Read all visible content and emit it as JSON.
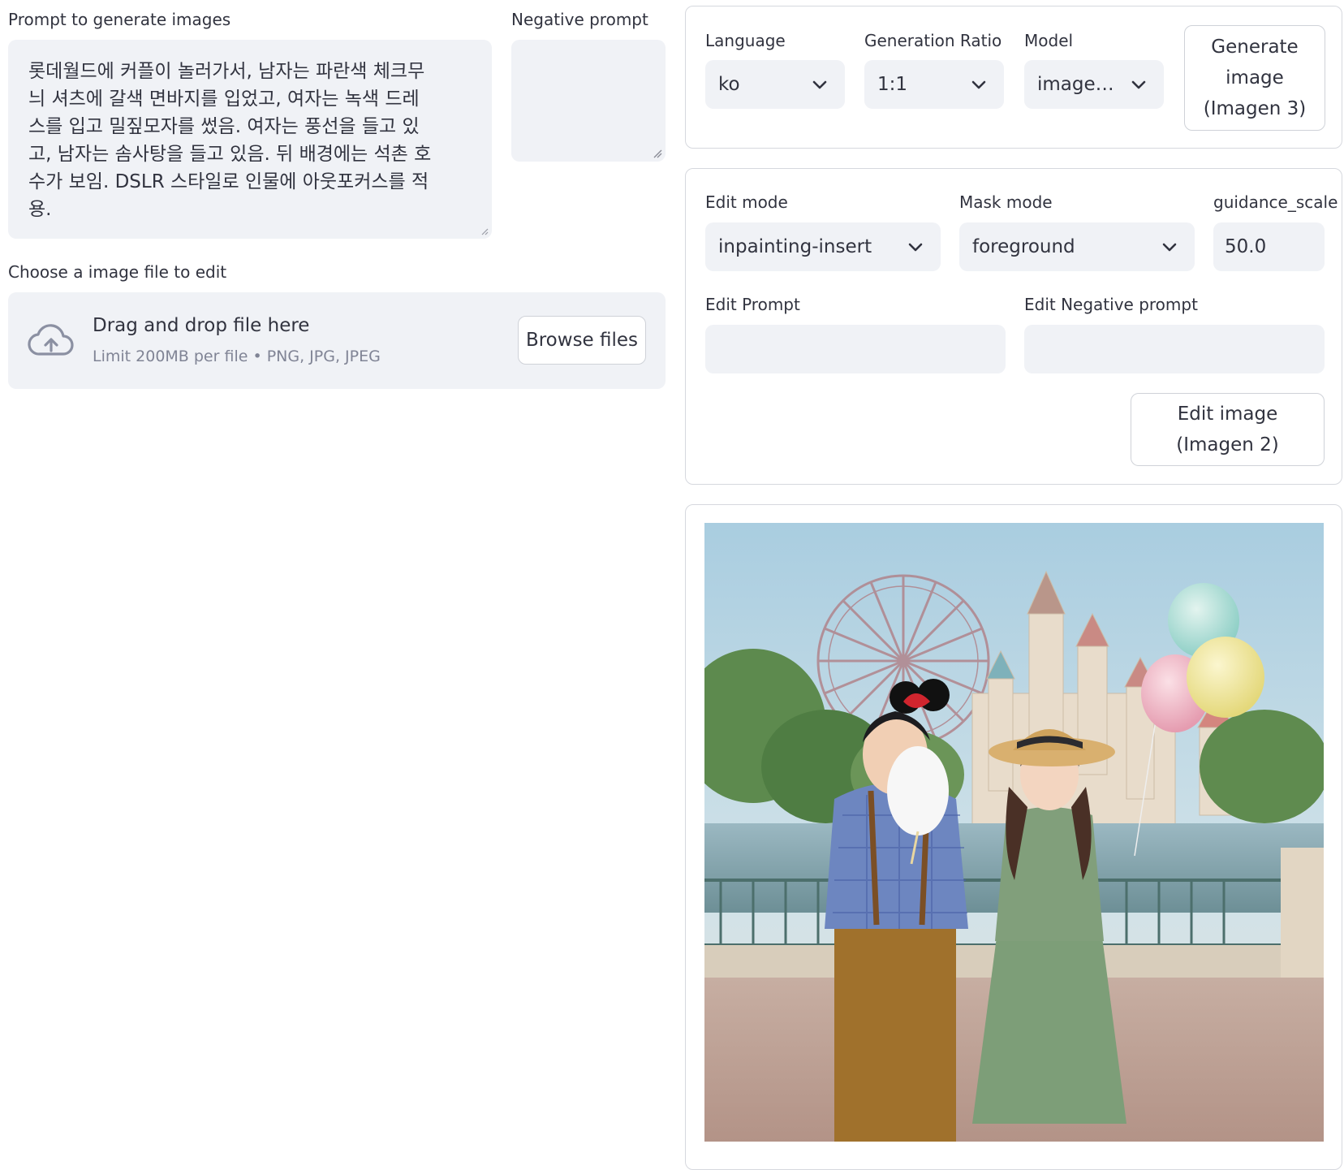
{
  "generate_form": {
    "prompt_label": "Prompt to generate images",
    "prompt_value": "롯데월드에 커플이 놀러가서, 남자는 파란색 체크무\n늬 셔츠에 갈색 면바지를 입었고, 여자는 녹색 드레\n스를 입고 밀짚모자를 썼음. 여자는 풍선을 들고 있\n고, 남자는 솜사탕을 들고 있음. 뒤 배경에는 석촌 호\n수가 보임. DSLR 스타일로 인물에 아웃포커스를 적\n용.",
    "negative_prompt_label": "Negative prompt",
    "negative_prompt_value": ""
  },
  "upload": {
    "label": "Choose a image file to edit",
    "drag_text": "Drag and drop file here",
    "limit_text": "Limit 200MB per file • PNG, JPG, JPEG",
    "browse_label": "Browse files",
    "icon": "cloud-upload-icon"
  },
  "generation_settings": {
    "language_label": "Language",
    "language_value": "ko",
    "ratio_label": "Generation Ratio",
    "ratio_value": "1:1",
    "model_label": "Model",
    "model_value": "image…",
    "generate_button_label": "Generate image (Imagen 3)"
  },
  "edit_settings": {
    "edit_mode_label": "Edit mode",
    "edit_mode_value": "inpainting-insert",
    "mask_mode_label": "Mask mode",
    "mask_mode_value": "foreground",
    "guidance_label": "guidance_scale",
    "guidance_value": "50.0",
    "edit_prompt_label": "Edit Prompt",
    "edit_prompt_value": "",
    "edit_negative_label": "Edit Negative prompt",
    "edit_negative_value": "",
    "edit_button_label": "Edit image (Imagen 2)"
  },
  "result": {
    "image_name": "generated-image"
  },
  "colors": {
    "field_bg": "#f0f2f6",
    "border": "#d6d8de",
    "text": "#31333f",
    "muted": "#808495"
  }
}
